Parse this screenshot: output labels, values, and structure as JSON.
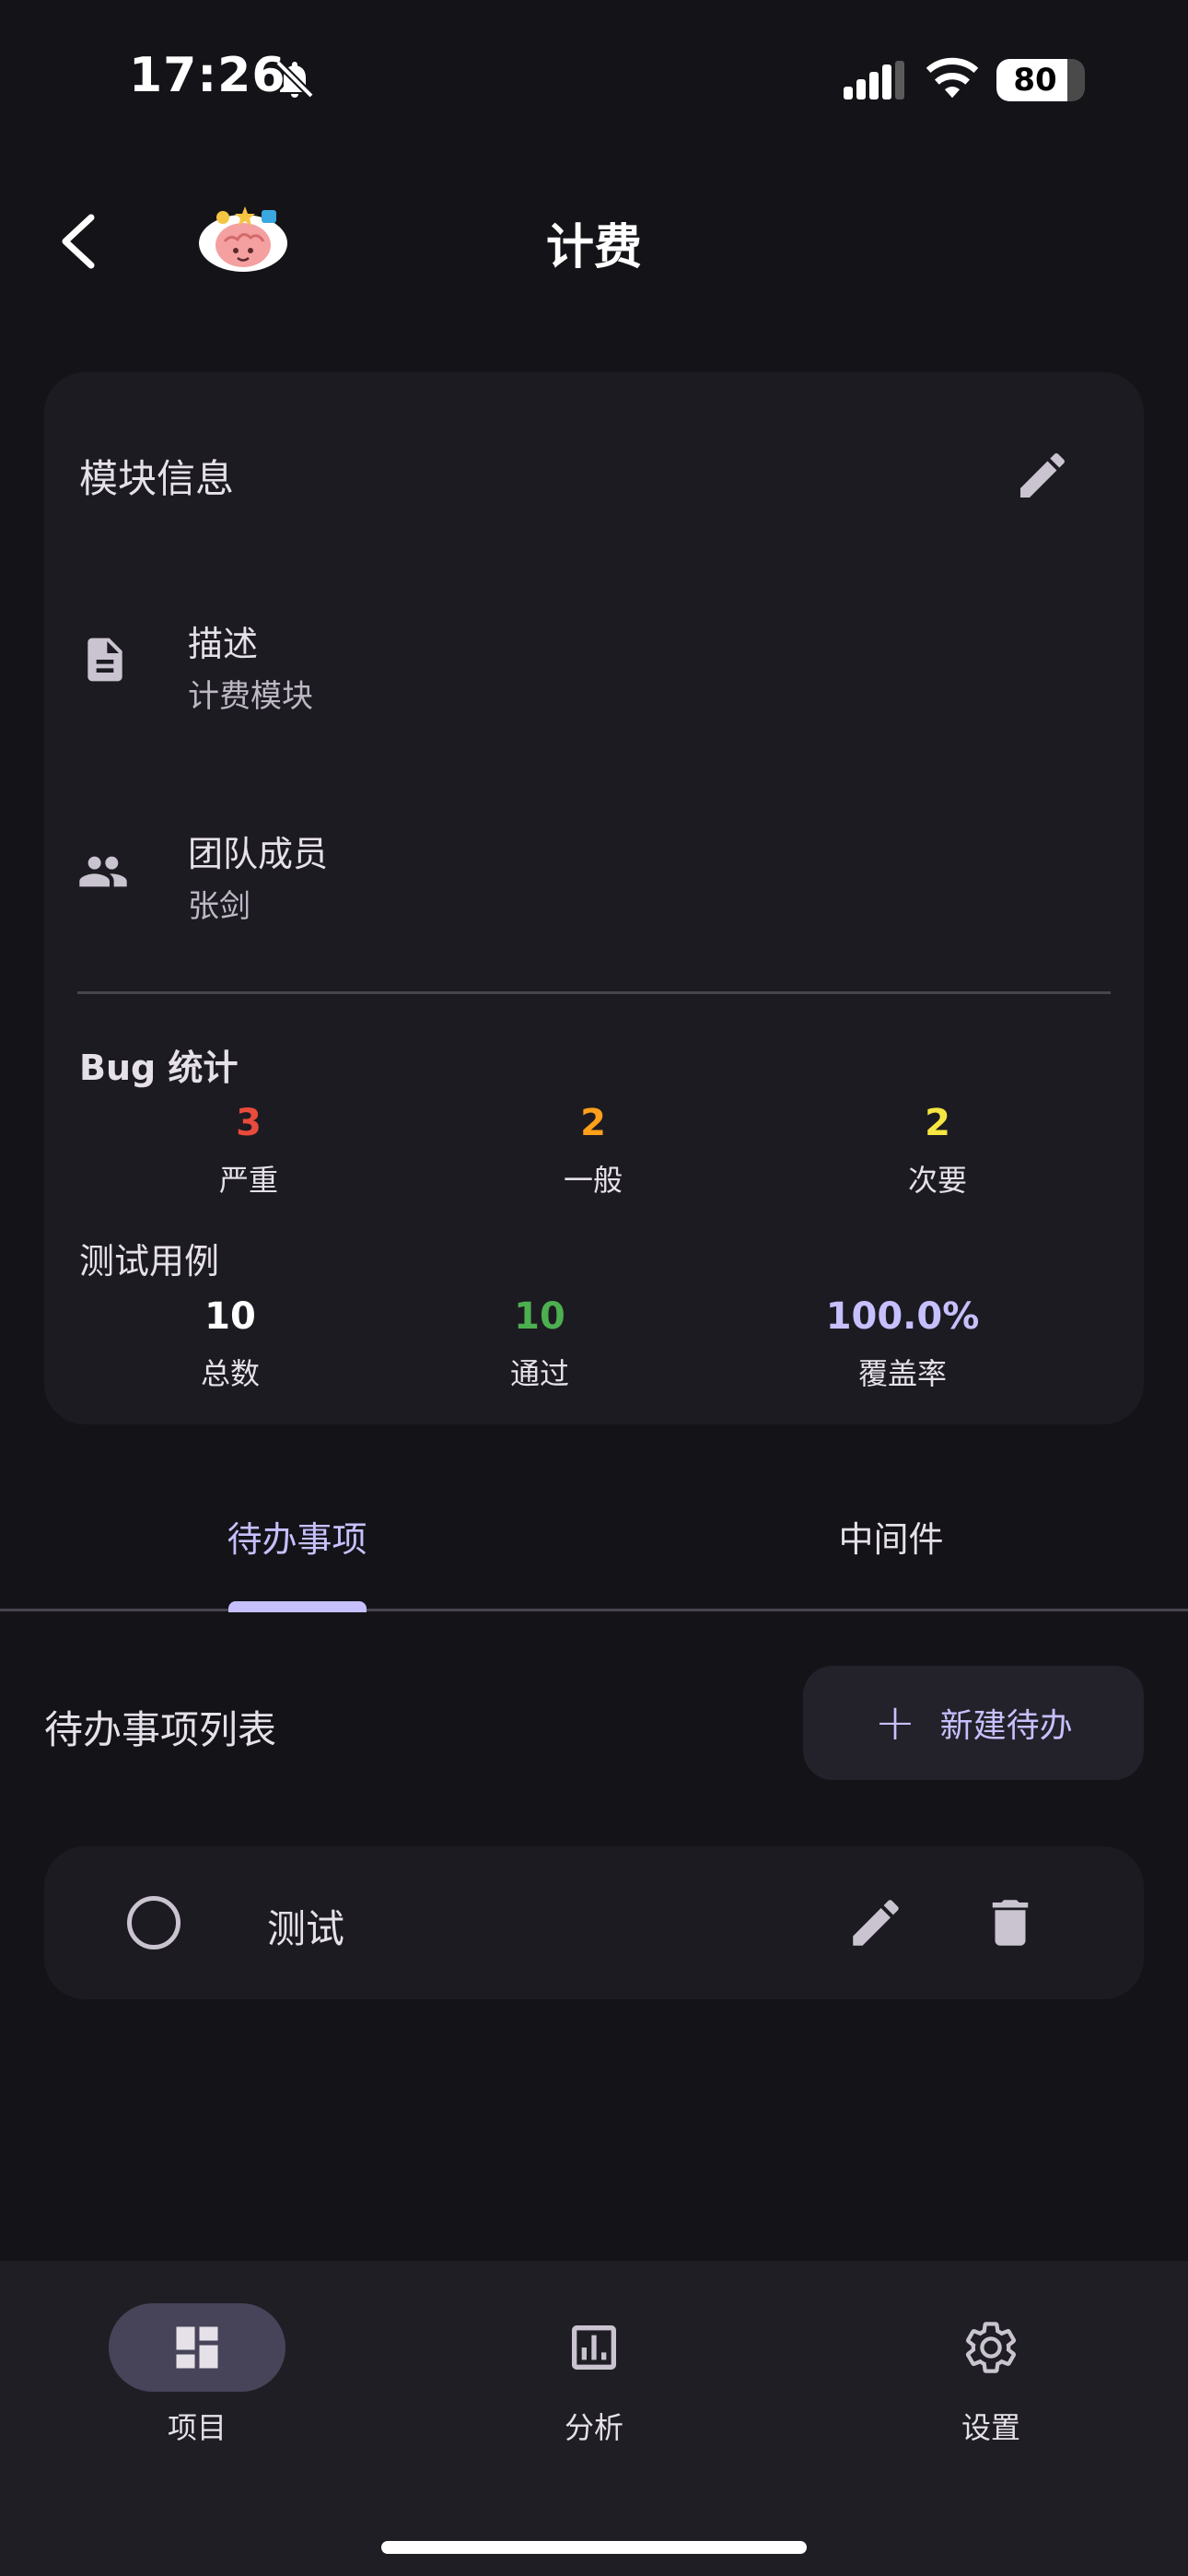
{
  "status_bar": {
    "time": "17:26",
    "battery": "80"
  },
  "header": {
    "title": "计费"
  },
  "module_info": {
    "title": "模块信息",
    "rows": [
      {
        "icon": "description-icon",
        "label": "描述",
        "value": "计费模块"
      },
      {
        "icon": "people-icon",
        "label": "团队成员",
        "value": "张剑"
      }
    ],
    "bug_stats": {
      "title": "Bug 统计",
      "items": [
        {
          "value": "3",
          "label": "严重",
          "color": "#e94b3c"
        },
        {
          "value": "2",
          "label": "一般",
          "color": "#ff9f1a"
        },
        {
          "value": "2",
          "label": "次要",
          "color": "#f5e642"
        }
      ]
    },
    "test_cases": {
      "title": "测试用例",
      "items": [
        {
          "value": "10",
          "label": "总数",
          "color": "#ffffff"
        },
        {
          "value": "10",
          "label": "通过",
          "color": "#4caf50"
        },
        {
          "value": "100.0%",
          "label": "覆盖率",
          "color": "#c6c0ff"
        }
      ]
    }
  },
  "tabs": [
    {
      "label": "待办事项",
      "active": true
    },
    {
      "label": "中间件",
      "active": false
    }
  ],
  "todo": {
    "list_title": "待办事项列表",
    "new_button": "新建待办",
    "items": [
      {
        "text": "测试",
        "done": false
      }
    ]
  },
  "bottom_nav": [
    {
      "icon": "dashboard-icon",
      "label": "项目",
      "active": true
    },
    {
      "icon": "analytics-icon",
      "label": "分析",
      "active": false
    },
    {
      "icon": "settings-gear-icon",
      "label": "设置",
      "active": false
    }
  ],
  "colors": {
    "accent": "#c6c0ff",
    "background": "#141318",
    "surface": "#1d1b22"
  }
}
